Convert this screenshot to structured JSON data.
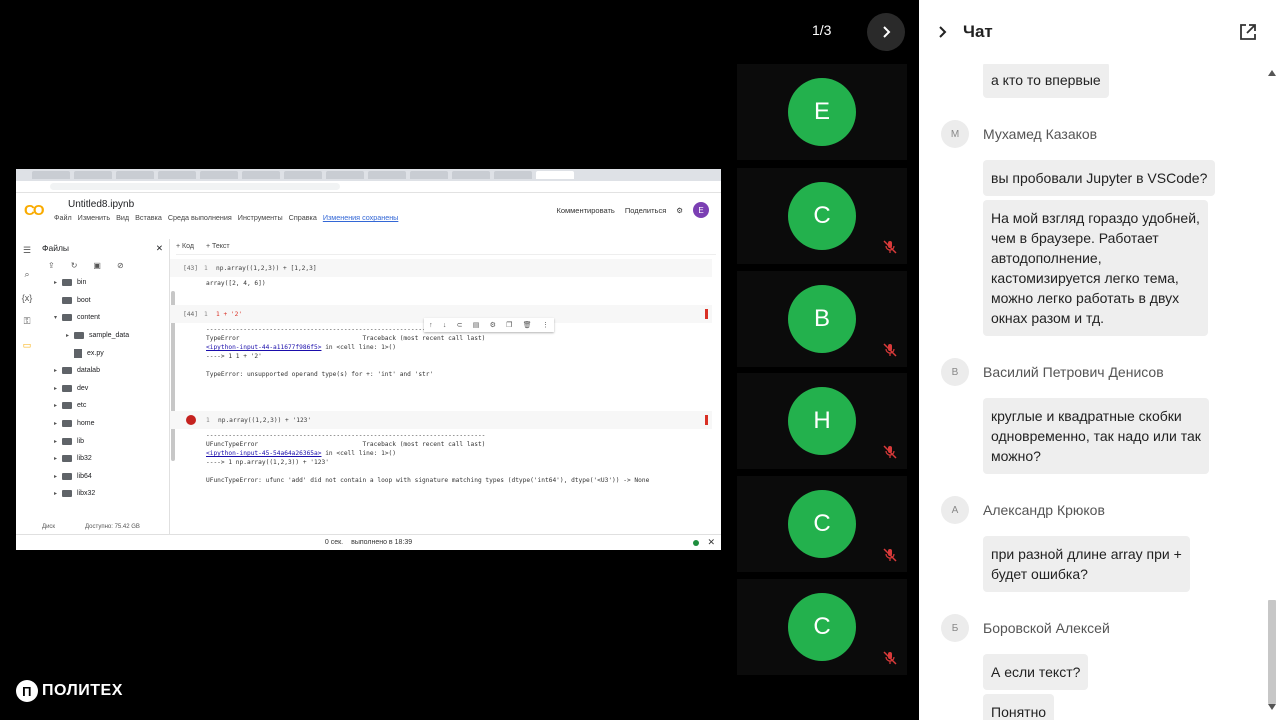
{
  "pager": {
    "label": "1/3"
  },
  "colab": {
    "notebook_title": "Untitled8.ipynb",
    "menu": [
      "Файл",
      "Изменить",
      "Вид",
      "Вставка",
      "Среда выполнения",
      "Инструменты",
      "Справка"
    ],
    "saved_label": "Изменения сохранены",
    "comment_label": "Комментировать",
    "share_label": "Поделиться",
    "user_initial": "E",
    "files_title": "Файлы",
    "toolbar": {
      "code": "+ Код",
      "text": "+ Текст"
    },
    "files": [
      {
        "name": "bin",
        "type": "folder",
        "expander": "▸",
        "indent": 0
      },
      {
        "name": "boot",
        "type": "folder",
        "expander": "",
        "indent": 0
      },
      {
        "name": "content",
        "type": "folder",
        "expander": "▾",
        "indent": 0
      },
      {
        "name": "sample_data",
        "type": "folder",
        "expander": "▸",
        "indent": 1
      },
      {
        "name": "ex.py",
        "type": "file",
        "expander": "",
        "indent": 1
      },
      {
        "name": "datalab",
        "type": "folder",
        "expander": "▸",
        "indent": 0
      },
      {
        "name": "dev",
        "type": "folder",
        "expander": "▸",
        "indent": 0
      },
      {
        "name": "etc",
        "type": "folder",
        "expander": "▸",
        "indent": 0
      },
      {
        "name": "home",
        "type": "folder",
        "expander": "▸",
        "indent": 0
      },
      {
        "name": "lib",
        "type": "folder",
        "expander": "▸",
        "indent": 0
      },
      {
        "name": "lib32",
        "type": "folder",
        "expander": "▸",
        "indent": 0
      },
      {
        "name": "lib64",
        "type": "folder",
        "expander": "▸",
        "indent": 0
      },
      {
        "name": "libx32",
        "type": "folder",
        "expander": "▸",
        "indent": 0
      }
    ],
    "disk_label": "Диск",
    "disk_free": "Доступно: 75.42 GB",
    "cells": [
      {
        "num": "[43]",
        "line": "1",
        "code": "np.array((1,2,3)) + [1,2,3]",
        "output": "array([2, 4, 6])"
      },
      {
        "num": "[44]",
        "line": "1",
        "code": "1 + '2'",
        "out_rule": "---------------------------------------------------------------------------",
        "out_head": "TypeError                                 Traceback (most recent call last)",
        "out_link": "<ipython-input-44-a11677f986f5>",
        "out_link_tail": " in <cell line: 1>()",
        "out_line": "----> 1 1 + '2'",
        "out_err": "TypeError: unsupported operand type(s) for +: 'int' and 'str'"
      },
      {
        "num": "",
        "line": "1",
        "code": "np.array((1,2,3)) + '123'",
        "out_rule": "---------------------------------------------------------------------------",
        "out_head": "UFuncTypeError                            Traceback (most recent call last)",
        "out_link": "<ipython-input-45-54a64a26365a>",
        "out_link_tail": " in <cell line: 1>()",
        "out_line": "----> 1 np.array((1,2,3)) + '123'",
        "out_err": "UFuncTypeError: ufunc 'add' did not contain a loop with signature matching types (dtype('int64'), dtype('<U3')) -> None"
      }
    ],
    "status_time": "0 сек.",
    "status_done": "выполнено в 18:39"
  },
  "participants": [
    {
      "initial": "E",
      "muted": false
    },
    {
      "initial": "C",
      "muted": true
    },
    {
      "initial": "B",
      "muted": true
    },
    {
      "initial": "H",
      "muted": true
    },
    {
      "initial": "C",
      "muted": true
    },
    {
      "initial": "C",
      "muted": true
    }
  ],
  "brand": {
    "mark": "П",
    "text": "ПОЛИТЕХ"
  },
  "chat": {
    "title": "Чат",
    "messages": [
      {
        "author": "",
        "initial": "",
        "bubbles": [
          "а кто то впервые"
        ]
      },
      {
        "author": "Мухамед Казаков",
        "initial": "М",
        "bubbles": [
          "вы пробовали Jupyter в VSCode?",
          "На мой взгляд гораздо удобней,\nчем в браузере. Работает\nавтодополнение,\nкастомизируется легко тема,\nможно легко работать в двух\nокнах разом и тд."
        ]
      },
      {
        "author": "Василий Петрович Денисов",
        "initial": "В",
        "bubbles": [
          "круглые и квадратные скобки\nодновременно, так надо или так\nможно?"
        ]
      },
      {
        "author": "Александр Крюков",
        "initial": "А",
        "bubbles": [
          "при разной длине array при +\nбудет ошибка?"
        ]
      },
      {
        "author": "Боровской Алексей",
        "initial": "Б",
        "bubbles": [
          "А если текст?",
          "Понятно"
        ]
      }
    ]
  }
}
